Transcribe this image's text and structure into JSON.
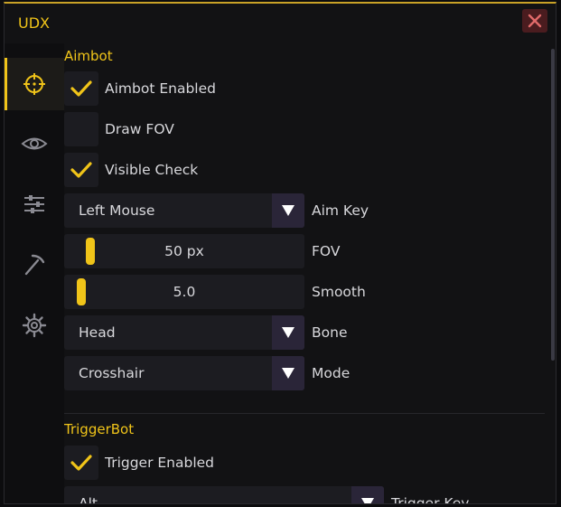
{
  "window": {
    "title": "UDX"
  },
  "sidebar": {
    "items": [
      {
        "id": "aimbot",
        "icon": "crosshair-icon",
        "active": true
      },
      {
        "id": "visuals",
        "icon": "eye-icon",
        "active": false
      },
      {
        "id": "settings",
        "icon": "sliders-icon",
        "active": false
      },
      {
        "id": "misc",
        "icon": "pickaxe-icon",
        "active": false
      },
      {
        "id": "config",
        "icon": "gear-icon",
        "active": false
      }
    ]
  },
  "aimbot": {
    "title": "Aimbot",
    "aimbot_enabled": {
      "label": "Aimbot Enabled",
      "checked": true
    },
    "draw_fov": {
      "label": "Draw FOV",
      "checked": false
    },
    "visible_check": {
      "label": "Visible Check",
      "checked": true
    },
    "aim_key": {
      "value": "Left Mouse",
      "label": "Aim Key"
    },
    "fov": {
      "value": "50 px",
      "label": "FOV",
      "fraction": 0.05
    },
    "smooth": {
      "value": "5.0",
      "label": "Smooth",
      "fraction": 0.0
    },
    "bone": {
      "value": "Head",
      "label": "Bone"
    },
    "mode": {
      "value": "Crosshair",
      "label": "Mode"
    }
  },
  "triggerbot": {
    "title": "TriggerBot",
    "trigger_enabled": {
      "label": "Trigger Enabled",
      "checked": true
    },
    "trigger_key": {
      "value": "Alt",
      "label": "Trigger Key"
    }
  },
  "colors": {
    "accent": "#f0c419",
    "close": "#e06a6a",
    "arrow_bg": "#2a2538"
  }
}
